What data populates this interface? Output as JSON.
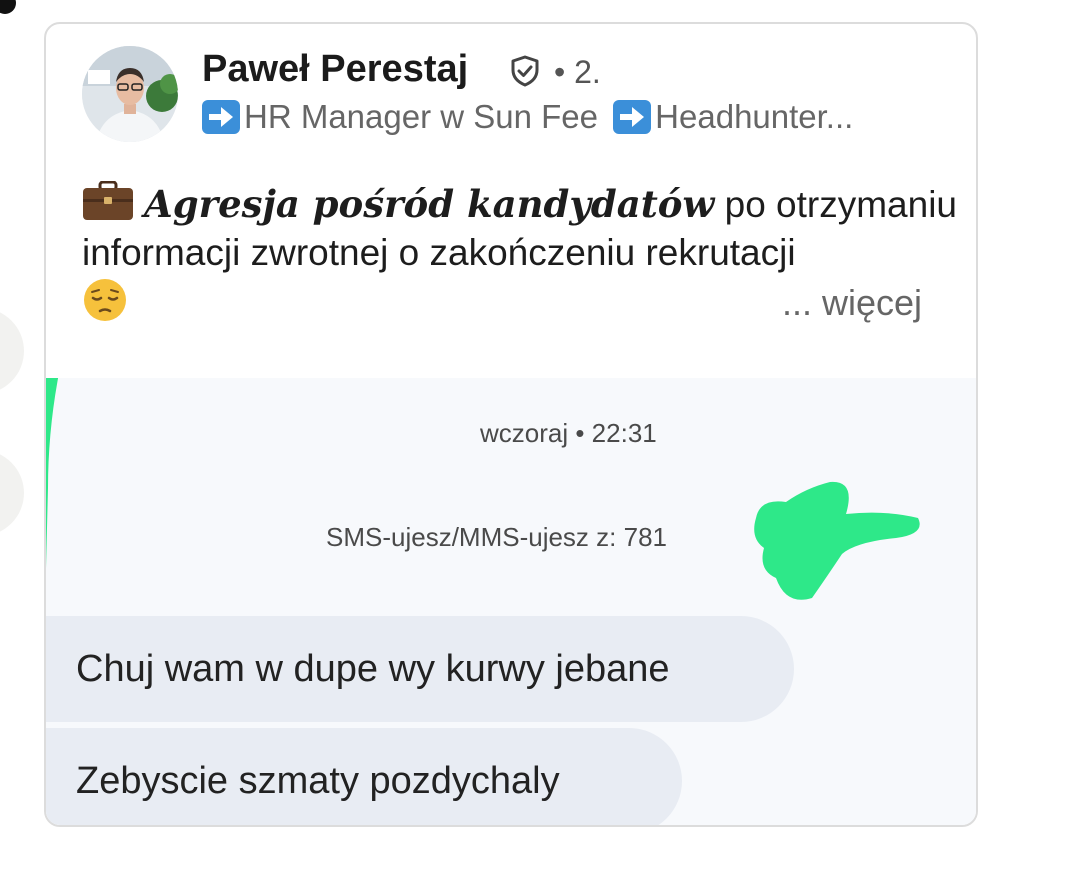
{
  "post": {
    "author_name": "Paweł Perestaj",
    "degree": "• 2.",
    "headline_part1": "HR Manager w Sun Fee",
    "headline_part2": "Headhunter...",
    "title_bold": "Agresja pośród kandydatów",
    "body_text": " po otrzymaniu informacji zwrotnej o zakończeniu rekrutacji",
    "more_label": "... więcej"
  },
  "sms": {
    "timestamp": "wczoraj • 22:31",
    "sender_label": "SMS-ujesz/MMS-ujesz z: 781",
    "messages": [
      {
        "text": "Chuj wam w dupe wy kurwy jebane"
      },
      {
        "text": "Zebyscie szmaty pozdychaly"
      }
    ]
  },
  "icons": {
    "verified": "shield-check-icon",
    "headline_arrow": "right-arrow-emoji-icon",
    "briefcase": "briefcase-emoji-icon",
    "pensive": "pensive-face-emoji-icon"
  },
  "colors": {
    "redaction_green": "#2ee889",
    "bubble_bg": "#e8ecf3",
    "panel_bg": "#f7f9fc",
    "arrow_blue": "#3b8fd9"
  }
}
